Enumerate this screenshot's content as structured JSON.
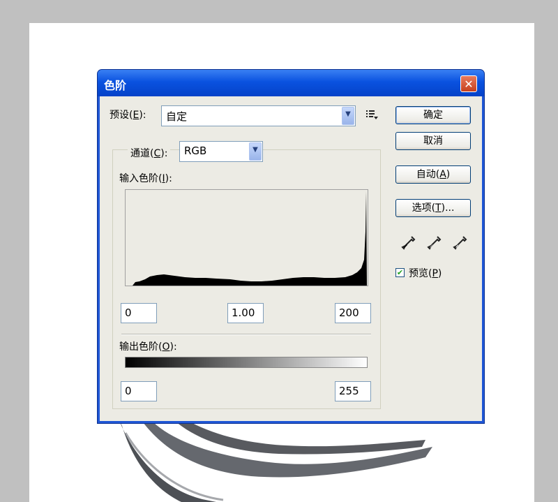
{
  "dialog": {
    "title": "色阶",
    "close_glyph": "✕",
    "preset": {
      "label_pre": "预设(",
      "label_key": "E",
      "label_post": "):",
      "value": "自定",
      "menu_icon": "list-menu-icon"
    },
    "channel": {
      "label_pre": "通道(",
      "label_key": "C",
      "label_post": "):",
      "value": "RGB"
    },
    "input_levels": {
      "label_pre": "输入色阶(",
      "label_key": "I",
      "label_post": "):",
      "black": "0",
      "gamma": "1.00",
      "white": "200"
    },
    "output_levels": {
      "label_pre": "输出色阶(",
      "label_key": "O",
      "label_post": "):",
      "black": "0",
      "white": "255"
    },
    "buttons": {
      "ok": "确定",
      "cancel": "取消",
      "auto_pre": "自动(",
      "auto_key": "A",
      "auto_post": ")",
      "options_pre": "选项(",
      "options_key": "T",
      "options_post": ")..."
    },
    "preview": {
      "label_pre": "预览(",
      "label_key": "P",
      "label_post": ")",
      "checked": true
    },
    "eyedroppers": [
      "black-eyedropper-icon",
      "gray-eyedropper-icon",
      "white-eyedropper-icon"
    ]
  }
}
